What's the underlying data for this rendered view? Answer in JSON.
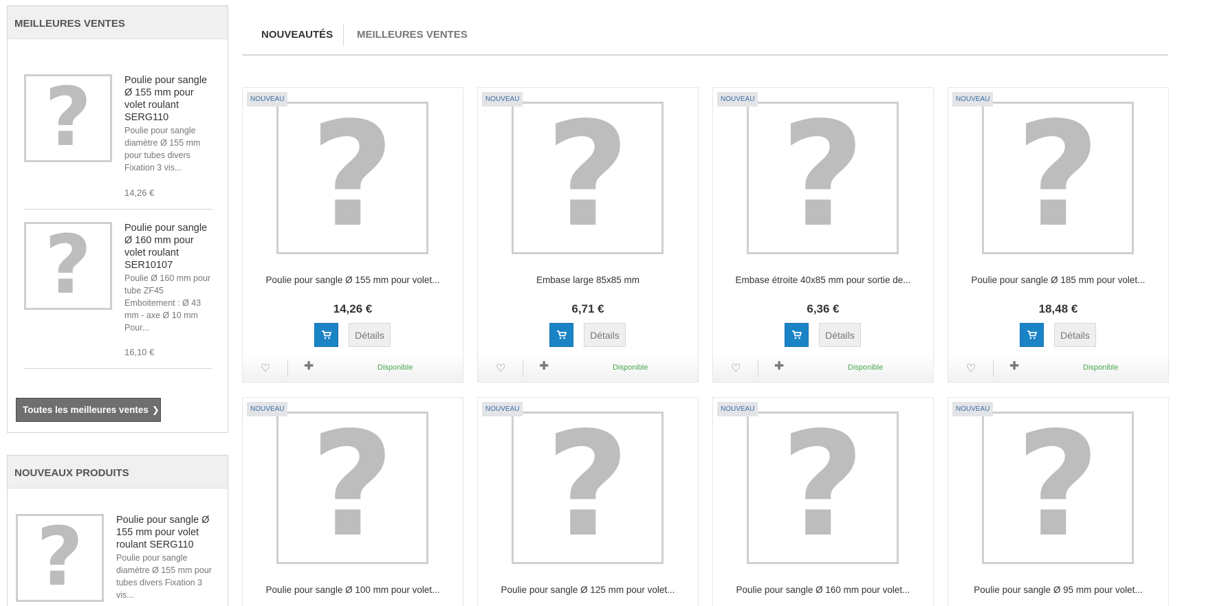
{
  "best_sellers": {
    "title": "MEILLEURES VENTES",
    "items": [
      {
        "name": "Poulie pour sangle Ø 155 mm pour volet roulant SERG110",
        "description": "Poulie pour sangle diamètre Ø 155 mm pour tubes divers Fixation 3 vis...",
        "price": "14,26 €"
      },
      {
        "name": "Poulie pour sangle Ø 160 mm pour volet roulant SER10107",
        "description": "Poulie Ø 160 mm pour tube ZF45 Emboitement : Ø 43 mm - axe Ø 10 mm Pour...",
        "price": "16,10 €"
      }
    ],
    "all_button_label": "Toutes les meilleures ventes",
    "all_button_chevron": "❯"
  },
  "new_products": {
    "title": "NOUVEAUX PRODUITS",
    "items": [
      {
        "name": "Poulie pour sangle Ø 155 mm pour volet roulant SERG110",
        "description": "Poulie pour sangle diamètre Ø 155 mm pour tubes divers Fixation 3 vis..."
      }
    ]
  },
  "tabs": [
    {
      "label": "NOUVEAUTÉS",
      "active": true
    },
    {
      "label": "MEILLEURES VENTES",
      "active": false
    }
  ],
  "placeholder_glyph": "?",
  "product_labels": {
    "new_badge": "NOUVEAU",
    "details": "Détails",
    "availability": "Disponible",
    "heart_glyph": "♡",
    "plus_glyph": "✚"
  },
  "products": [
    {
      "name": "Poulie pour sangle Ø 155 mm pour volet...",
      "price": "14,26 €"
    },
    {
      "name": "Embase large 85x85 mm",
      "price": "6,71 €"
    },
    {
      "name": "Embase étroite 40x85 mm pour sortie de...",
      "price": "6,36 €"
    },
    {
      "name": "Poulie pour sangle Ø 185 mm pour volet...",
      "price": "18,48 €"
    },
    {
      "name": "Poulie pour sangle Ø 100 mm pour volet...",
      "price": ""
    },
    {
      "name": "Poulie pour sangle Ø 125 mm pour volet...",
      "price": ""
    },
    {
      "name": "Poulie pour sangle Ø 160 mm pour volet...",
      "price": ""
    },
    {
      "name": "Poulie pour sangle Ø 95 mm pour volet...",
      "price": ""
    }
  ],
  "colors": {
    "cart_blue": "#1a83c6",
    "new_badge_text": "#3d6fa1",
    "availability_green": "#46a74e",
    "dark_button": "#6f6f6f"
  }
}
